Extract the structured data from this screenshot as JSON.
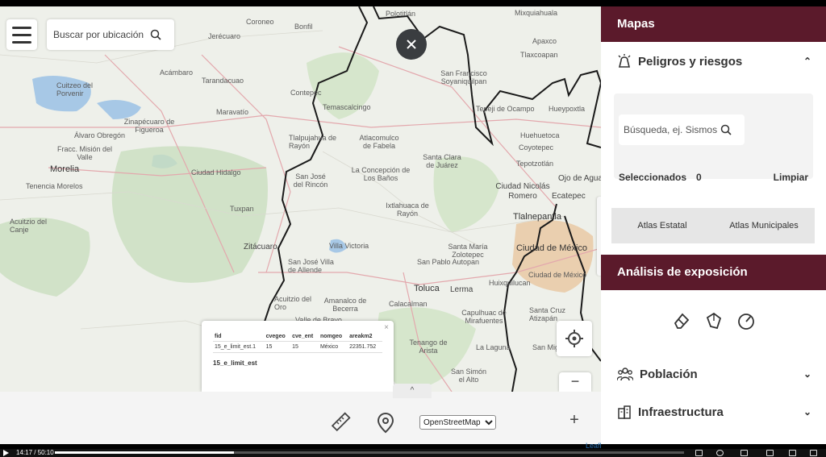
{
  "map": {
    "search_placeholder": "Buscar por ubicación",
    "places": [
      {
        "name": "Coroneo",
        "size": "small"
      },
      {
        "name": "Jerécuaro",
        "size": "small"
      },
      {
        "name": "Bonfil",
        "size": "small"
      },
      {
        "name": "Polotitlán",
        "size": "small"
      },
      {
        "name": "Mixquiahuala",
        "size": "small"
      },
      {
        "name": "Apaxco",
        "size": "small"
      },
      {
        "name": "Acámbaro",
        "size": "small"
      },
      {
        "name": "Tarandacuao",
        "size": "small"
      },
      {
        "name": "Contepec",
        "size": "small"
      },
      {
        "name": "Cuitzeo del Porvenir",
        "size": "small"
      },
      {
        "name": "Maravatío",
        "size": "small"
      },
      {
        "name": "Temascalcingo",
        "size": "small"
      },
      {
        "name": "San Francisco Soyaniquilpan",
        "size": "small"
      },
      {
        "name": "Tepeji de Ocampo",
        "size": "small"
      },
      {
        "name": "Tlaxcoapan",
        "size": "small"
      },
      {
        "name": "Álvaro Obregón",
        "size": "small"
      },
      {
        "name": "Zinapécuaro de Figueroa",
        "size": "small"
      },
      {
        "name": "Tlalpujahua de Rayón",
        "size": "small"
      },
      {
        "name": "Atlacomulco de Fabela",
        "size": "small"
      },
      {
        "name": "Huehuetoca",
        "size": "small"
      },
      {
        "name": "Hueypoxtla",
        "size": "small"
      },
      {
        "name": "Fracc. Misión del Valle",
        "size": "small"
      },
      {
        "name": "Coyotepec",
        "size": "small"
      },
      {
        "name": "Morelia",
        "size": "big"
      },
      {
        "name": "Ciudad Hidalgo",
        "size": "small"
      },
      {
        "name": "Santa Clara de Juárez",
        "size": "small"
      },
      {
        "name": "Tepotzotlán",
        "size": "small"
      },
      {
        "name": "Tenencia Morelos",
        "size": "small"
      },
      {
        "name": "San José del Rincón",
        "size": "small"
      },
      {
        "name": "La Concepción de Los Baños",
        "size": "small"
      },
      {
        "name": "Ojo de Agua",
        "size": "small"
      },
      {
        "name": "Ciudad Nicolás Romero",
        "size": "med"
      },
      {
        "name": "Ecatepec",
        "size": "med"
      },
      {
        "name": "Tuxpan",
        "size": "small"
      },
      {
        "name": "Ixtlahuaca de Rayón",
        "size": "small"
      },
      {
        "name": "Tlalnepantla",
        "size": "big"
      },
      {
        "name": "Acuitzio del Canje",
        "size": "small"
      },
      {
        "name": "Zitácuaro",
        "size": "med"
      },
      {
        "name": "Villa Victoria",
        "size": "small"
      },
      {
        "name": "Santa María Zolotepec",
        "size": "small"
      },
      {
        "name": "Ciudad de México",
        "size": "big"
      },
      {
        "name": "San José Villa de Allende",
        "size": "small"
      },
      {
        "name": "San Pablo Autopan",
        "size": "small"
      },
      {
        "name": "Ciudad de México",
        "size": "small"
      },
      {
        "name": "Toluca",
        "size": "big"
      },
      {
        "name": "Lerma",
        "size": "med"
      },
      {
        "name": "Huixquilucan",
        "size": "small"
      },
      {
        "name": "Santa Cruz Atizapán",
        "size": "small"
      },
      {
        "name": "Amanalco de Becerra",
        "size": "small"
      },
      {
        "name": "Calacalman",
        "size": "small"
      },
      {
        "name": "Capulhuac de Mirafuentes",
        "size": "small"
      },
      {
        "name": "Valle de Bravo",
        "size": "small"
      },
      {
        "name": "Tenango de Arista",
        "size": "small"
      },
      {
        "name": "La Laguna",
        "size": "small"
      },
      {
        "name": "San Simón el Alto",
        "size": "small"
      },
      {
        "name": "Acuitzio del Oro",
        "size": "small"
      },
      {
        "name": "San Miguel",
        "size": "small"
      }
    ],
    "popup": {
      "headers": [
        "fid",
        "cvegeo",
        "cve_ent",
        "nomgeo",
        "areakm2"
      ],
      "row": [
        "15_e_limit_est.1",
        "15",
        "15",
        "México",
        "22351.752"
      ],
      "footer": "15_e_limit_est",
      "close": "×"
    },
    "bottom": {
      "basemap_selected": "OpenStreetMap",
      "basemap_options": [
        "OpenStreetMap"
      ],
      "zoom_minus": "−",
      "add": "+",
      "tab_chevron": "^"
    },
    "attribution": "Leafl"
  },
  "sidebar": {
    "title": "Mapas",
    "riesgos": {
      "label": "Peligros y riesgos",
      "search_placeholder": "Búsqueda, ej. Sismos",
      "selected_label": "Seleccionados",
      "selected_count": "0",
      "clear_label": "Limpiar",
      "tabs": [
        "Atlas Estatal",
        "Atlas Municipales"
      ]
    },
    "exposure": {
      "title": "Análisis de exposición",
      "sections": [
        {
          "label": "Población"
        },
        {
          "label": "Infraestructura"
        }
      ]
    }
  },
  "player": {
    "time": "14:17 / 50:10",
    "progress": 0.285
  },
  "colors": {
    "brand": "#5b1a2b",
    "map_bg": "#eef0ea",
    "border": "#1a1a1a"
  }
}
